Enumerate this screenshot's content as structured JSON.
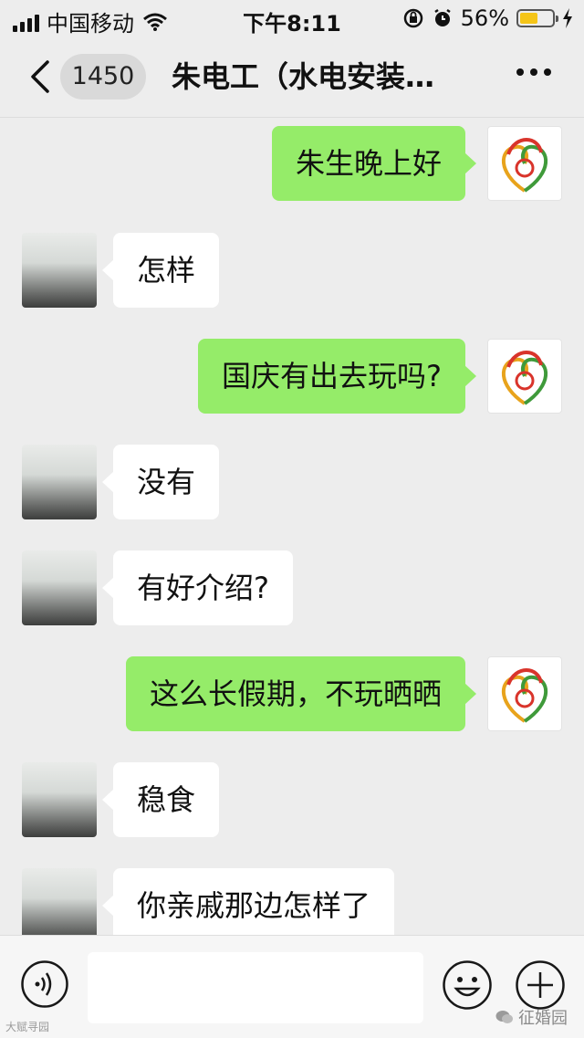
{
  "status_bar": {
    "carrier": "中国移动",
    "time": "下午8:11",
    "battery_percent": "56%",
    "battery_level": 0.56
  },
  "nav": {
    "unread_count": "1450",
    "title": "朱电工（水电安装…"
  },
  "messages": [
    {
      "from": "me",
      "text": "朱生晚上好"
    },
    {
      "from": "them",
      "text": "怎样"
    },
    {
      "from": "me",
      "text": "国庆有出去玩吗?"
    },
    {
      "from": "them",
      "text": "没有"
    },
    {
      "from": "them",
      "text": "有好介绍?"
    },
    {
      "from": "me",
      "text": "这么长假期，不玩晒晒"
    },
    {
      "from": "them",
      "text": "稳食"
    },
    {
      "from": "them",
      "text": "你亲戚那边怎样了"
    }
  ],
  "input_bar": {
    "input_value": "",
    "watermark_left": "大赋寻园",
    "watermark_right": "征婚园"
  },
  "colors": {
    "background": "#ededed",
    "my_bubble": "#95ec69",
    "their_bubble": "#ffffff",
    "battery": "#f5c518"
  },
  "icons": [
    "signal-icon",
    "wifi-icon",
    "rotation-lock-icon",
    "alarm-icon",
    "battery-icon",
    "charging-icon",
    "back-icon",
    "more-icon",
    "voice-icon",
    "emoji-icon",
    "plus-icon"
  ]
}
